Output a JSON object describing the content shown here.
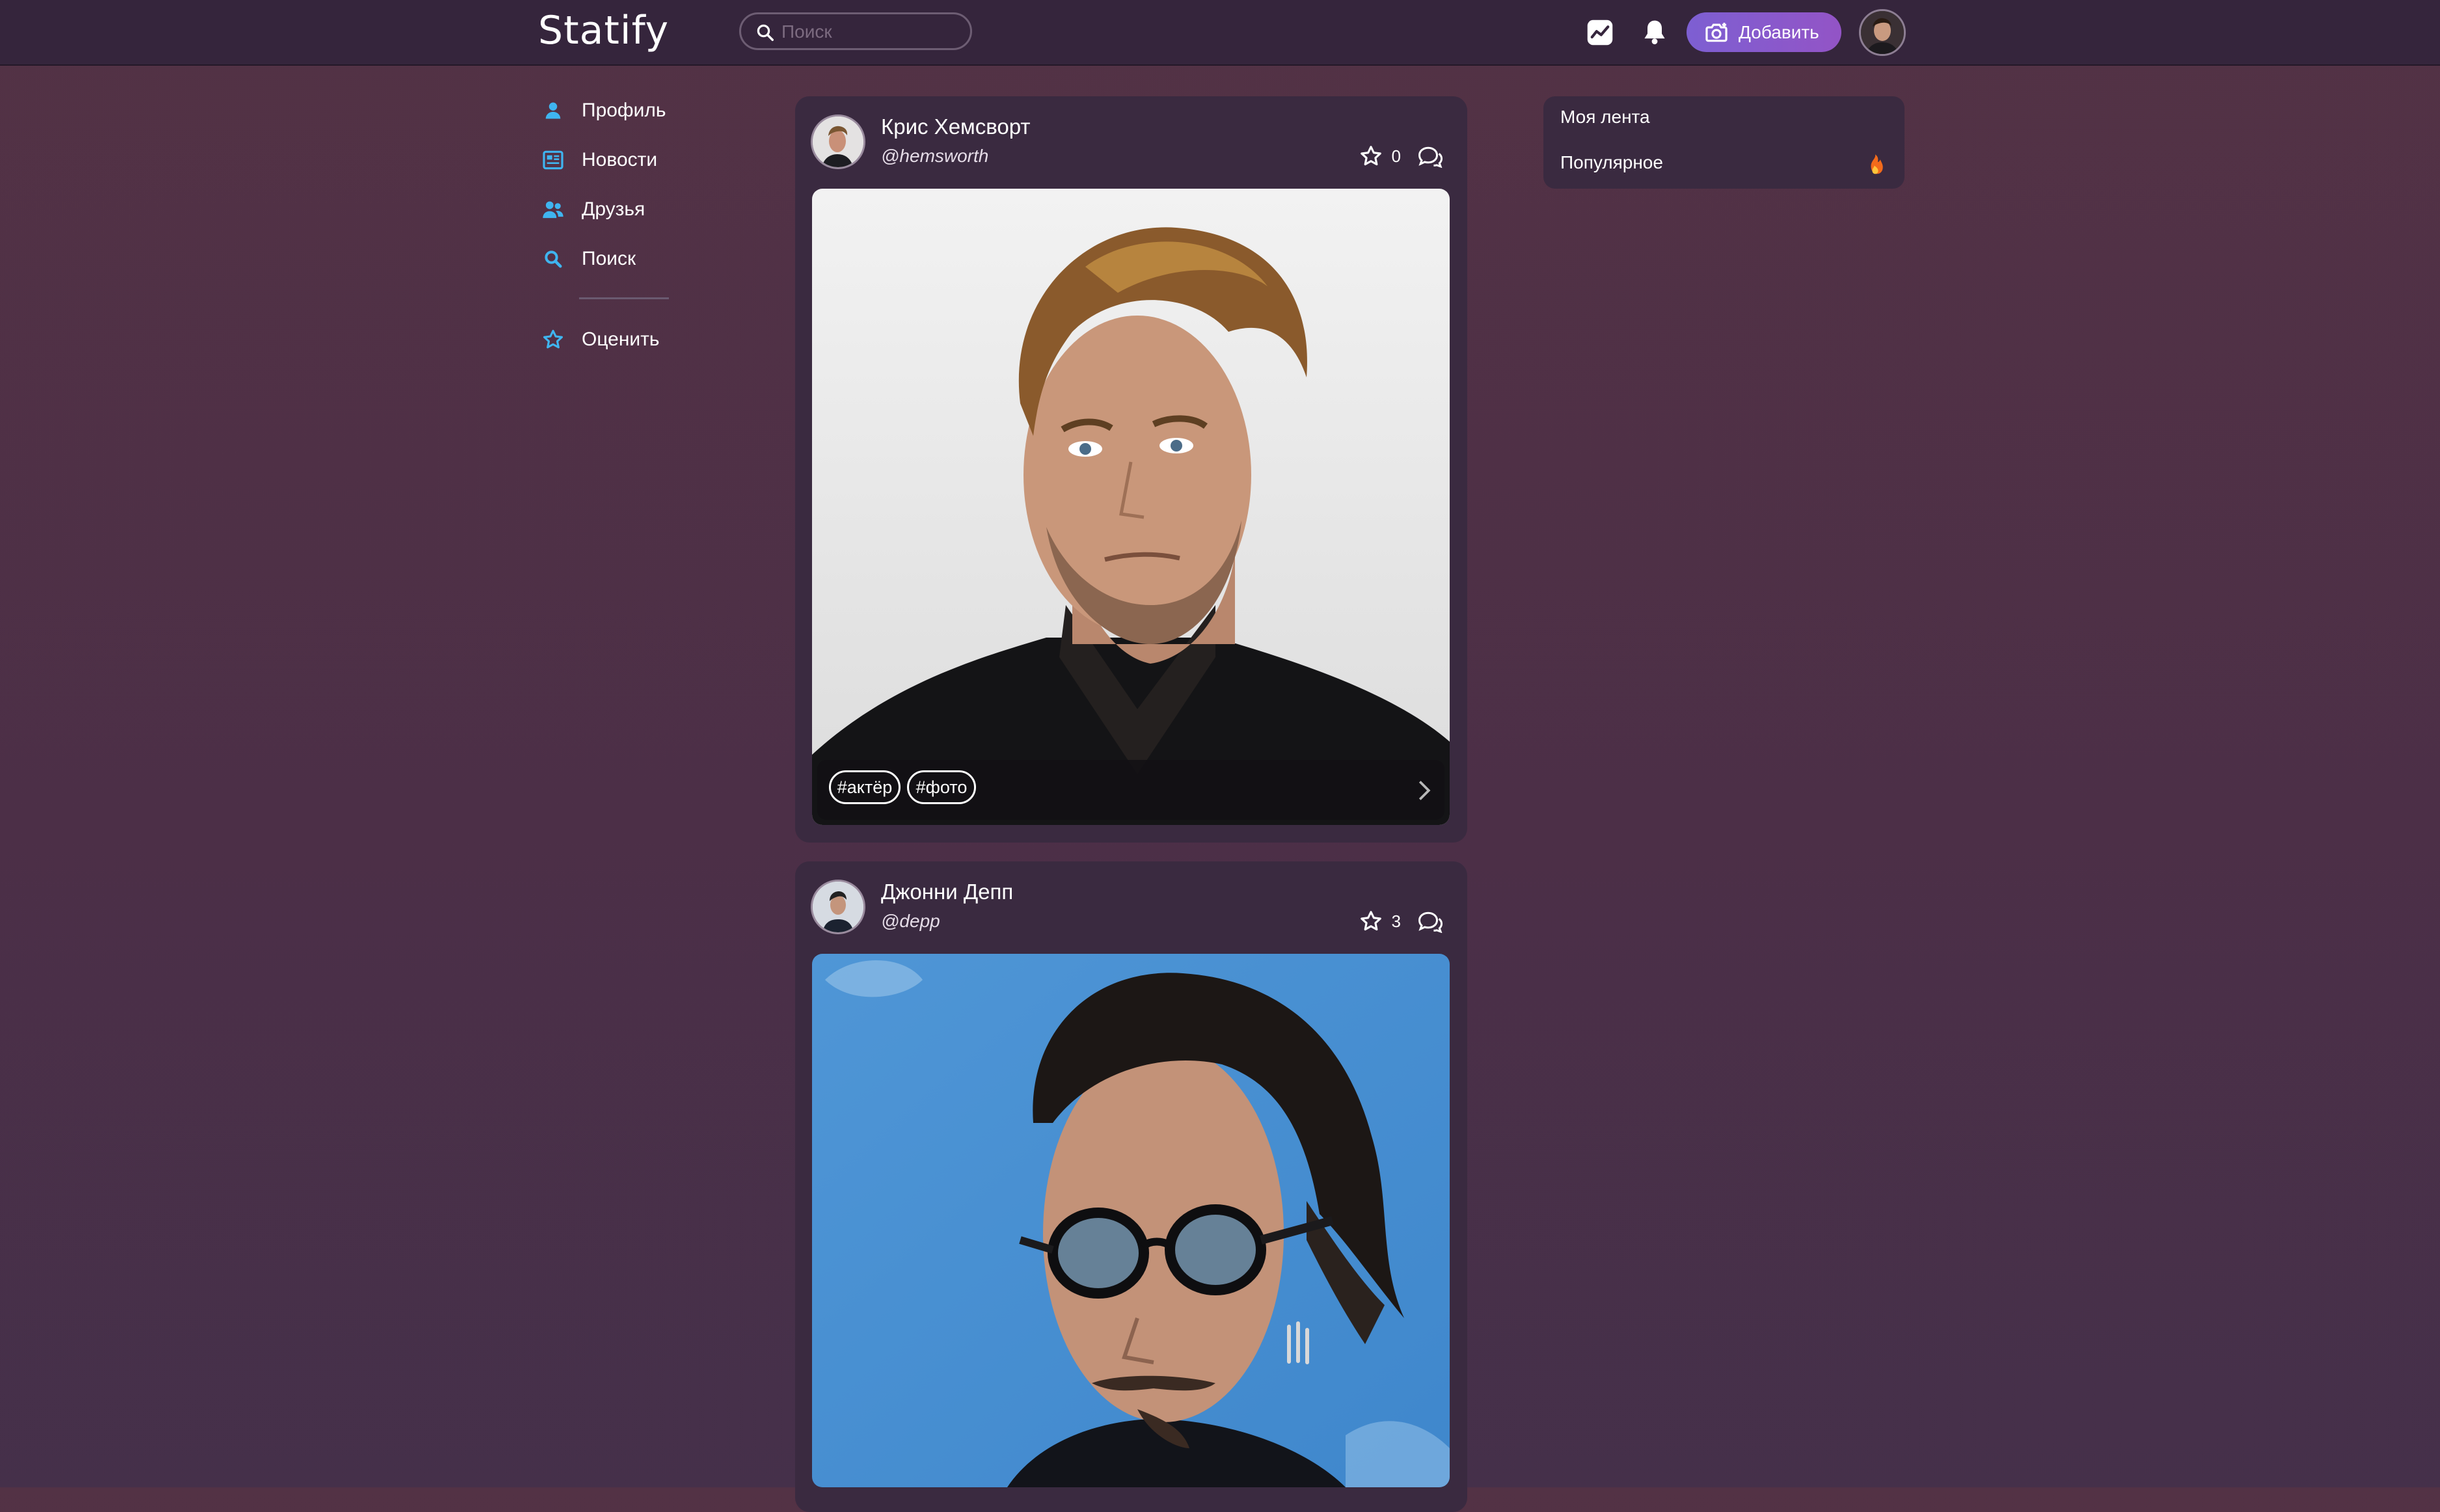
{
  "app": {
    "name": "Statify"
  },
  "topbar": {
    "search_placeholder": "Поиск",
    "add_button_label": "Добавить",
    "icons": [
      "stats-icon",
      "bell-icon",
      "camera-icon"
    ]
  },
  "sidebar": {
    "items": [
      {
        "label": "Профиль",
        "icon": "user-icon"
      },
      {
        "label": "Новости",
        "icon": "newspaper-icon"
      },
      {
        "label": "Друзья",
        "icon": "friends-icon"
      },
      {
        "label": "Поиск",
        "icon": "search-icon"
      },
      {
        "label": "Оценить",
        "icon": "star-icon"
      }
    ],
    "accent_color": "#3fb5f0"
  },
  "posts": [
    {
      "name": "Крис Хемсворт",
      "handle": "@hemsworth",
      "likes": "0",
      "tags": [
        "#актёр",
        "#фото"
      ]
    },
    {
      "name": "Джонни Депп",
      "handle": "@depp",
      "likes": "3",
      "tags": []
    }
  ],
  "feed_panel": {
    "items": [
      {
        "label": "Моя лента"
      },
      {
        "label": "Популярное",
        "icon": "fire-icon"
      }
    ]
  },
  "colors": {
    "background": "#4f3145",
    "panel": "#3a2a40",
    "topbar": "#35253c",
    "button_gradient_start": "#7d5fd2",
    "button_gradient_end": "#9354c6",
    "fire": "#f26a1b"
  }
}
